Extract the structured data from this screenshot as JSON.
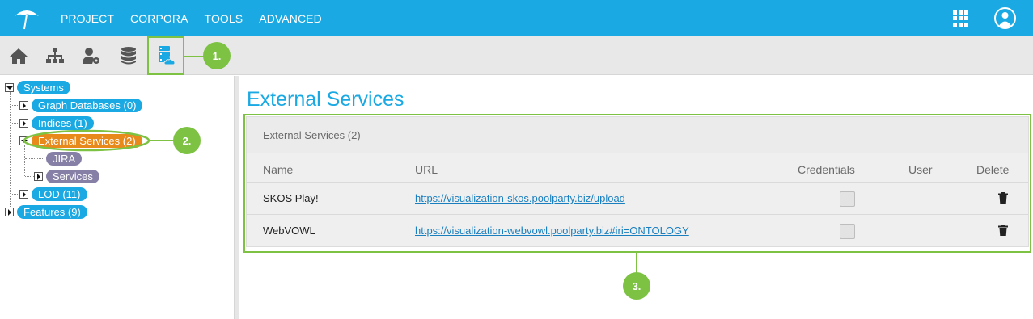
{
  "topnav": {
    "items": [
      "PROJECT",
      "CORPORA",
      "TOOLS",
      "ADVANCED"
    ]
  },
  "toolbar": {
    "tools": [
      "home-icon",
      "hierarchy-icon",
      "user-settings-icon",
      "database-icon",
      "external-services-icon"
    ],
    "active_tool": "external-services-icon"
  },
  "callouts": [
    "1.",
    "2.",
    "3."
  ],
  "tree": {
    "root": "Systems",
    "graph_databases": "Graph Databases (0)",
    "indices": "Indices (1)",
    "external_services": "External Services (2)",
    "jira": "JIRA",
    "services": "Services",
    "lod": "LOD (11)",
    "features": "Features (9)"
  },
  "main": {
    "title": "External Services",
    "panel_title": "External Services (2)",
    "columns": {
      "name": "Name",
      "url": "URL",
      "credentials": "Credentials",
      "user": "User",
      "delete": "Delete"
    },
    "rows": [
      {
        "name": "SKOS Play!",
        "url": "https://visualization-skos.poolparty.biz/upload",
        "credentials": false,
        "user": ""
      },
      {
        "name": "WebVOWL",
        "url": "https://visualization-webvowl.poolparty.biz#iri=ONTOLOGY",
        "credentials": false,
        "user": ""
      }
    ]
  },
  "colors": {
    "brand_blue": "#1aa9e3",
    "highlight_green": "#7dc243",
    "selected_orange": "#e8891b",
    "leaf_purple": "#8780a6"
  }
}
